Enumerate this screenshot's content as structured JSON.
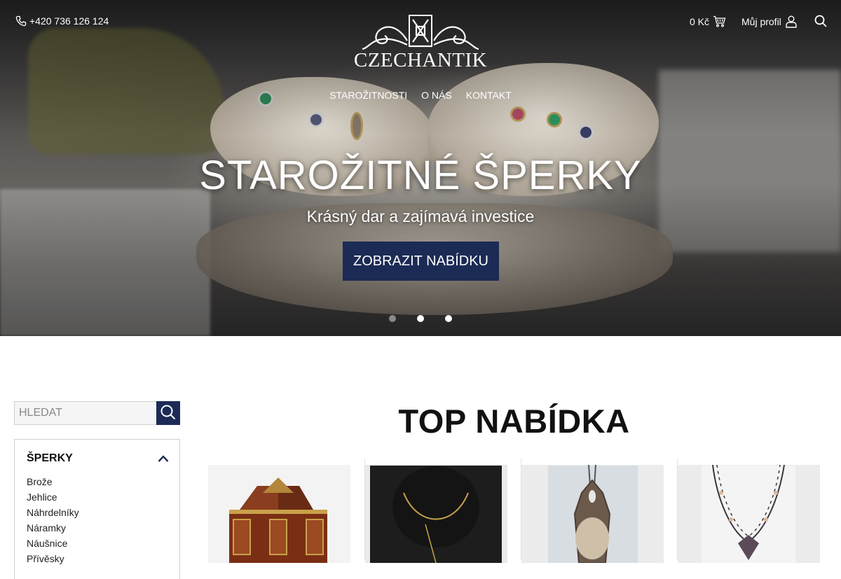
{
  "header": {
    "phone": "+420 736 126 124",
    "cart_total": "0 Kč",
    "profile_label": "Můj profil",
    "logo_text": "CZECHANTIK"
  },
  "nav": {
    "items": [
      "STAROŽITNOSTI",
      "O NÁS",
      "KONTAKT"
    ]
  },
  "hero": {
    "title": "STAROŽITNÉ ŠPERKY",
    "subtitle": "Krásný dar a zajímavá investice",
    "button_label": "ZOBRAZIT NABÍDKU",
    "slides_total": 3,
    "active_slide": 1
  },
  "sidebar": {
    "search_placeholder": "HLEDAT",
    "category_title": "ŠPERKY",
    "items": [
      "Brože",
      "Jehlice",
      "Náhrdelníky",
      "Náramky",
      "Náušnice",
      "Přívěsky"
    ]
  },
  "main": {
    "section_title": "TOP NABÍDKA"
  },
  "colors": {
    "accent": "#1c2b55",
    "text": "#111111"
  },
  "icons": {
    "phone": "phone-icon",
    "cart": "cart-icon",
    "profile": "user-icon",
    "search": "search-icon",
    "collapse": "chevron-up-icon"
  }
}
